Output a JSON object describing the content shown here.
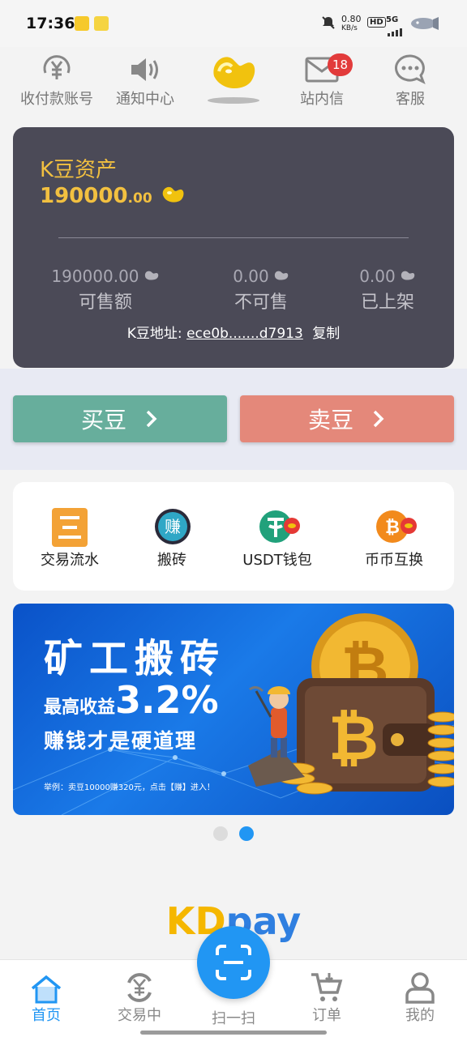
{
  "status_bar": {
    "time": "17:36",
    "net_speed": "0.80",
    "net_unit": "KB/s",
    "hd": "HD",
    "signal": "5G",
    "app_icon_1": "meituan-yellow-icon",
    "app_icon_2": "meituan-icon"
  },
  "topnav": {
    "items": [
      {
        "label": "收付款账号",
        "icon": "yen-circle-icon"
      },
      {
        "label": "通知中心",
        "icon": "speaker-icon"
      },
      {
        "label": "",
        "icon": "golden-bean-logo"
      },
      {
        "label": "站内信",
        "icon": "mail-icon",
        "badge": "18"
      },
      {
        "label": "客服",
        "icon": "chat-bubble-icon"
      }
    ]
  },
  "asset": {
    "title": "K豆资产",
    "balance_int": "190000",
    "balance_dec": ".00",
    "stats": [
      {
        "value": "190000.00",
        "label": "可售额"
      },
      {
        "value": "0.00",
        "label": "不可售"
      },
      {
        "value": "0.00",
        "label": "已上架"
      }
    ],
    "address_label": "K豆地址:",
    "address_value": "ece0b.......d7913",
    "copy_label": "复制"
  },
  "actions": {
    "buy_label": "买豆",
    "buy_color": "#67ae9c",
    "sell_label": "卖豆",
    "sell_color": "#e4887a"
  },
  "quick_menu": [
    {
      "label": "交易流水",
      "icon": "ledger-icon"
    },
    {
      "label": "搬砖",
      "icon": "earn-icon"
    },
    {
      "label": "USDT钱包",
      "icon": "tether-icon"
    },
    {
      "label": "币币互换",
      "icon": "bitcoin-swap-icon"
    }
  ],
  "banner": {
    "headline": "矿工搬砖",
    "yield_prefix": "最高收益",
    "yield_value": "3.2%",
    "slogan": "赚钱才是硬道理",
    "note": "举例：卖豆10000赚320元，点击【赚】进入！"
  },
  "carousel": {
    "count": 2,
    "active": 1
  },
  "brand": {
    "kd": "KD",
    "pay": "pay"
  },
  "bottom_nav": [
    {
      "label": "首页",
      "icon": "home-icon",
      "active": true
    },
    {
      "label": "交易中",
      "icon": "exchange-icon",
      "active": false
    },
    {
      "label": "扫一扫",
      "icon": "scan-icon",
      "active": false
    },
    {
      "label": "订单",
      "icon": "cart-icon",
      "active": false
    },
    {
      "label": "我的",
      "icon": "user-icon",
      "active": false
    }
  ],
  "colors": {
    "accent": "#2196f3",
    "gold": "#f2c040",
    "card": "#4b4a57"
  }
}
